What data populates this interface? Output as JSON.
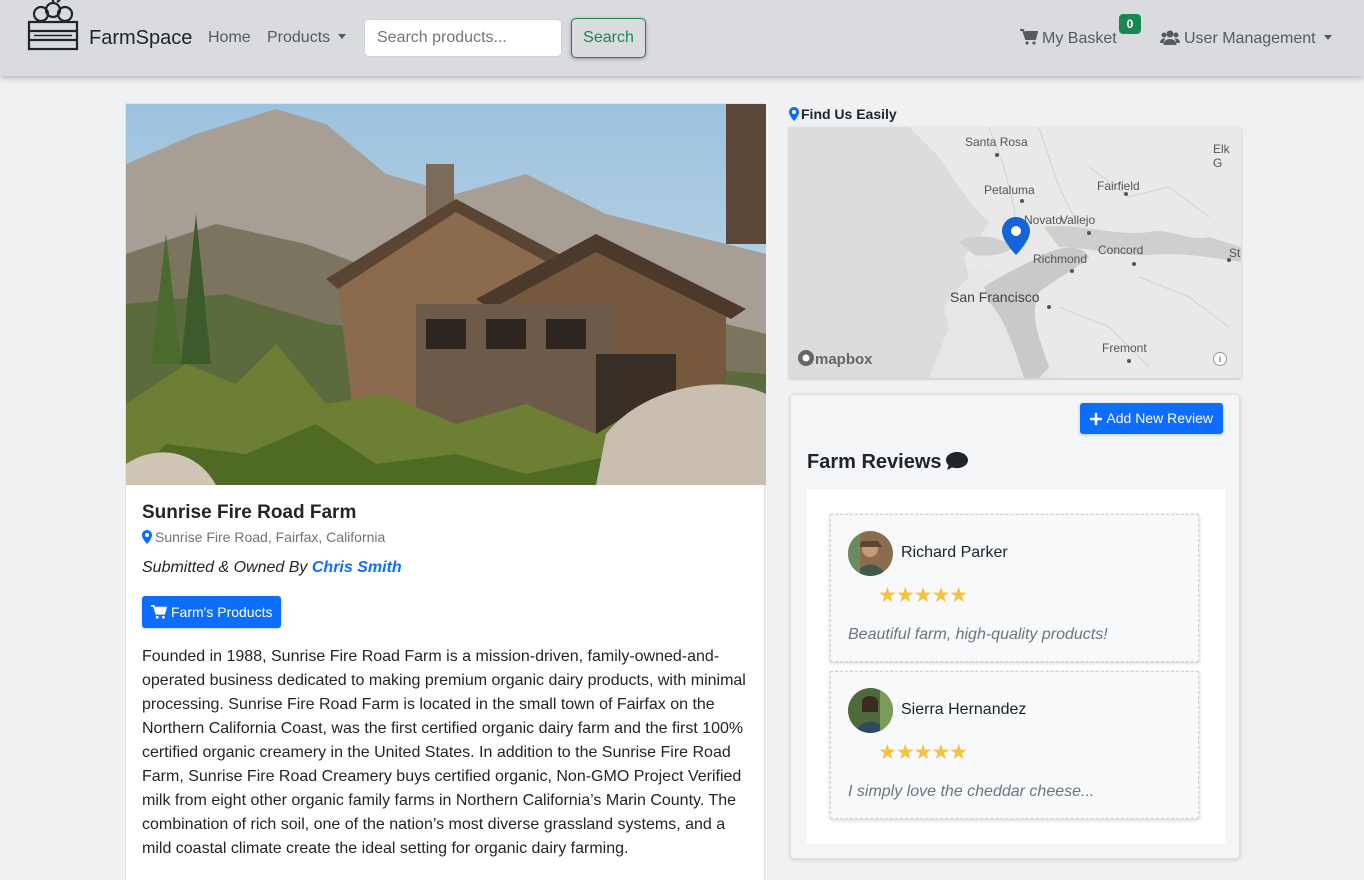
{
  "navbar": {
    "brand": "FarmSpace",
    "home": "Home",
    "products": "Products",
    "search_placeholder": "Search products...",
    "search_button": "Search",
    "basket_label": "My Basket",
    "basket_count": "0",
    "user_management": "User Management"
  },
  "farm": {
    "name": "Sunrise Fire Road Farm",
    "location": "Sunrise Fire Road, Fairfax, California",
    "owner_prefix": "Submitted & Owned By",
    "owner_name": "Chris Smith",
    "products_button": "Farm's Products",
    "description": "Founded in 1988, Sunrise Fire Road Farm is a mission-driven, family-owned-and-operated business dedicated to making premium organic dairy products, with minimal processing. Sunrise Fire Road Farm is located in the small town of Fairfax on the Northern California Coast, was the first certified organic dairy farm and the first 100% certified organic creamery in the United States. In addition to the Sunrise Fire Road Farm, Sunrise Fire Road Creamery buys certified organic, Non-GMO Project Verified milk from eight other organic family farms in Northern California’s Marin County. The combination of rich soil, one of the nation’s most diverse grassland systems, and a mild coastal climate create the ideal setting for organic dairy farming."
  },
  "map": {
    "title": "Find Us Easily",
    "labels": [
      "Santa Rosa",
      "Elk G",
      "Fairfield",
      "Petaluma",
      "Vallejo",
      "Novato",
      "Concord",
      "Richmond",
      "St",
      "San Francisco",
      "Fremont"
    ],
    "attribution": "mapbox"
  },
  "reviews": {
    "add_button": "Add New Review",
    "heading": "Farm Reviews",
    "items": [
      {
        "name": "Richard Parker",
        "stars": "★★★★★",
        "rating": 5,
        "text": "Beautiful farm, high-quality products!"
      },
      {
        "name": "Sierra Hernandez",
        "stars": "★★★★★",
        "rating": 5,
        "text": "I simply love the cheddar cheese..."
      }
    ]
  }
}
